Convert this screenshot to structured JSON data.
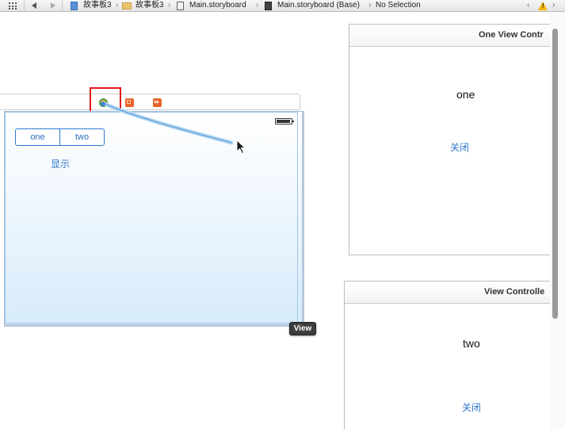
{
  "jumpbar": {
    "crumbs": [
      {
        "label": "故事板3",
        "icon": "project-icon"
      },
      {
        "label": "故事板3",
        "icon": "folder-icon"
      },
      {
        "label": "Main.storyboard",
        "icon": "storyboard-file-icon"
      },
      {
        "label": "Main.storyboard (Base)",
        "icon": "storyboard-base-icon"
      },
      {
        "label": "No Selection",
        "icon": ""
      }
    ],
    "nav_icons": [
      "related-items-icon",
      "back-arrow-icon",
      "forward-arrow-icon"
    ],
    "status_icon": "warning-icon"
  },
  "scene_main": {
    "dock_icons": [
      "view-controller-icon",
      "first-responder-icon",
      "exit-icon"
    ],
    "segments": [
      "one",
      "two"
    ],
    "show_button": "显示",
    "view_badge": "View",
    "colors": {
      "highlight": "#e0161b",
      "tint": "#2f76c8",
      "connection_line": "#6aa9e0"
    }
  },
  "scene_one": {
    "title": "One View Contr",
    "label": "one",
    "close_button": "关闭"
  },
  "scene_two": {
    "title": "View Controlle",
    "label": "two",
    "close_button": "关闭"
  }
}
